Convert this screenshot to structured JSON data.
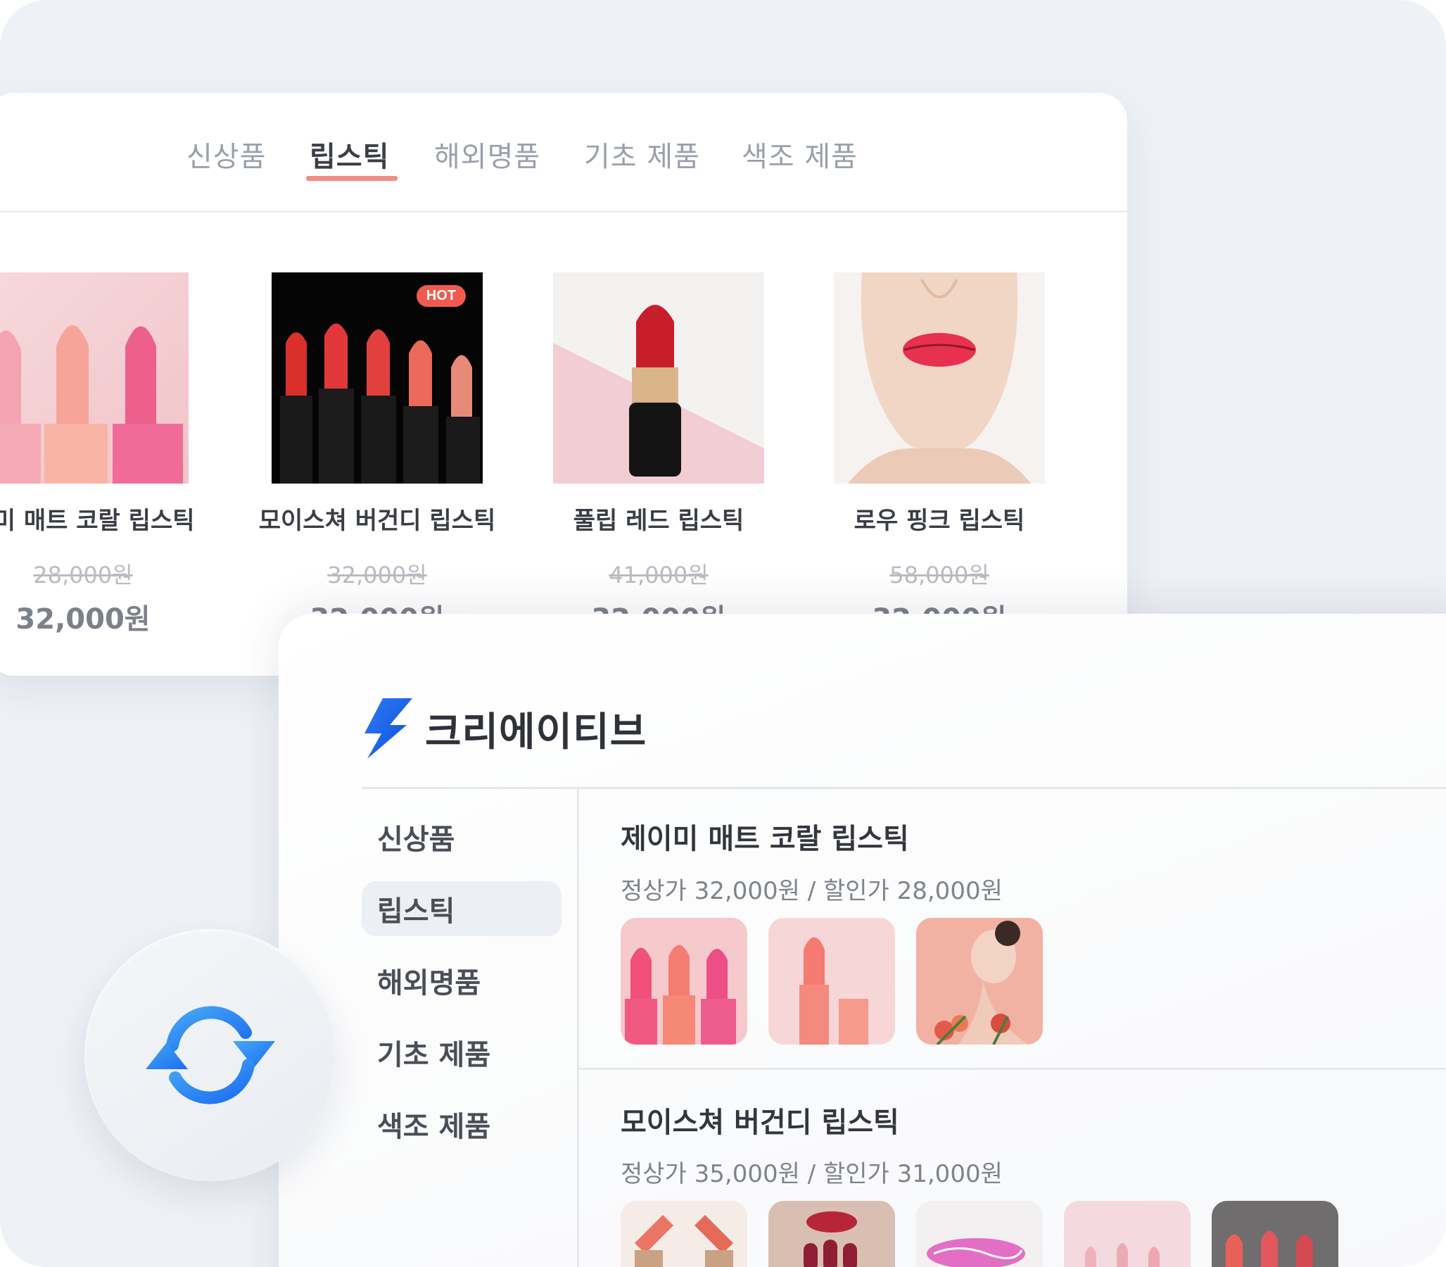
{
  "shop": {
    "tabs": [
      {
        "label": "신상품",
        "active": false
      },
      {
        "label": "립스틱",
        "active": true
      },
      {
        "label": "해외명품",
        "active": false
      },
      {
        "label": "기초 제품",
        "active": false
      },
      {
        "label": "색조 제품",
        "active": false
      }
    ],
    "products": [
      {
        "name": "이미 매트 코랄 립스틱",
        "original_price": "28,000원",
        "sale_price": "32,000원",
        "badge": ""
      },
      {
        "name": "모이스쳐 버건디 립스틱",
        "original_price": "32,000원",
        "sale_price": "32,000원",
        "badge": "HOT"
      },
      {
        "name": "풀립 레드 립스틱",
        "original_price": "41,000원",
        "sale_price": "32,000원",
        "badge": ""
      },
      {
        "name": "로우 핑크 립스틱",
        "original_price": "58,000원",
        "sale_price": "32,000원",
        "badge": ""
      }
    ]
  },
  "admin": {
    "brand_name": "크리에이티브",
    "sidebar": [
      {
        "label": "신상품",
        "active": false
      },
      {
        "label": "립스틱",
        "active": true
      },
      {
        "label": "해외명품",
        "active": false
      },
      {
        "label": "기초 제품",
        "active": false
      },
      {
        "label": "색조 제품",
        "active": false
      }
    ],
    "sections": [
      {
        "title": "제이미 매트 코랄 립스틱",
        "price_line": "정상가 32,000원 / 할인가 28,000원"
      },
      {
        "title": "모이스쳐 버건디 립스틱",
        "price_line": "정상가 35,000원 / 할인가 31,000원"
      }
    ]
  },
  "colors": {
    "accent": "#f08c84",
    "hot_badge": "#f05a4f",
    "brand_blue": "#1f6cf0",
    "sync_blue": "#2f8cf0"
  },
  "icons": {
    "brand": "lightning-bolt-icon",
    "sync": "sync-arrows-icon"
  }
}
